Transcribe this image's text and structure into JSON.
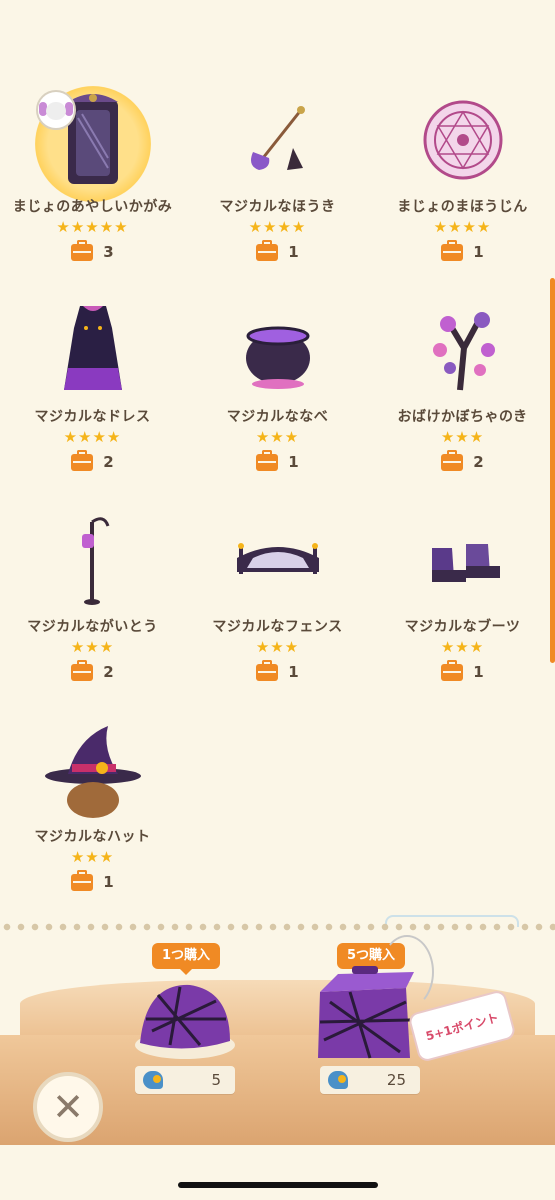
{
  "items": [
    {
      "name": "まじょのあやしいかがみ",
      "stars": "★★★★★",
      "count": "3",
      "icon": "mirror-icon",
      "selected": true
    },
    {
      "name": "マジカルなほうき",
      "stars": "★★★★",
      "count": "1",
      "icon": "broom-icon"
    },
    {
      "name": "まじょのまほうじん",
      "stars": "★★★★",
      "count": "1",
      "icon": "magic-circle-icon"
    },
    {
      "name": "マジカルなドレス",
      "stars": "★★★★",
      "count": "2",
      "icon": "dress-icon"
    },
    {
      "name": "マジカルななべ",
      "stars": "★★★",
      "count": "1",
      "icon": "cauldron-icon"
    },
    {
      "name": "おばけかぼちゃのき",
      "stars": "★★★",
      "count": "2",
      "icon": "pumpkin-tree-icon"
    },
    {
      "name": "マジカルながいとう",
      "stars": "★★★",
      "count": "2",
      "icon": "street-lamp-icon"
    },
    {
      "name": "マジカルなフェンス",
      "stars": "★★★",
      "count": "1",
      "icon": "fence-icon"
    },
    {
      "name": "マジカルなブーツ",
      "stars": "★★★",
      "count": "1",
      "icon": "boots-icon"
    },
    {
      "name": "マジカルなハット",
      "stars": "★★★",
      "count": "1",
      "icon": "hat-icon"
    }
  ],
  "purchase": {
    "single": {
      "label": "1つ購入",
      "price": "5",
      "icon": "fortune-cookie-icon"
    },
    "bundle": {
      "label": "5つ購入",
      "price": "25",
      "bonus": "5+1ポイント",
      "icon": "gift-box-icon"
    }
  },
  "close_icon": "close-icon",
  "colors": {
    "accent": "#f08a24",
    "star": "#f5b41a",
    "background": "#fbf6e7"
  }
}
